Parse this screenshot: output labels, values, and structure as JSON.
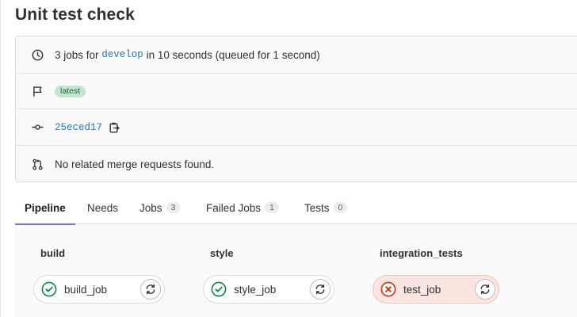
{
  "page": {
    "title": "Unit test check"
  },
  "info": {
    "summary_prefix": "3 jobs for",
    "branch": "develop",
    "summary_suffix": "in 10 seconds (queued for 1 second)",
    "badge": "latest",
    "commit_sha": "25eced17",
    "merge_requests": "No related merge requests found."
  },
  "tabs": [
    {
      "label": "Pipeline",
      "active": true
    },
    {
      "label": "Needs"
    },
    {
      "label": "Jobs",
      "count": "3"
    },
    {
      "label": "Failed Jobs",
      "count": "1"
    },
    {
      "label": "Tests",
      "count": "0"
    }
  ],
  "stages": [
    {
      "name": "build",
      "jobs": [
        {
          "name": "build_job",
          "status": "passed"
        }
      ]
    },
    {
      "name": "style",
      "jobs": [
        {
          "name": "style_job",
          "status": "passed"
        }
      ]
    },
    {
      "name": "integration_tests",
      "jobs": [
        {
          "name": "test_job",
          "status": "failed"
        }
      ]
    }
  ],
  "icons": {
    "summary": "clock-icon",
    "badge": "flag-icon",
    "commit": "commit-icon",
    "copy": "clipboard-icon",
    "merge": "merge-request-icon",
    "passed": "status-success-icon",
    "failed": "status-failed-icon",
    "retry": "retry-icon"
  },
  "colors": {
    "success": "#108548",
    "failed": "#dd2b0e",
    "link": "#1f75cb",
    "active_tab": "#7c70d6"
  }
}
